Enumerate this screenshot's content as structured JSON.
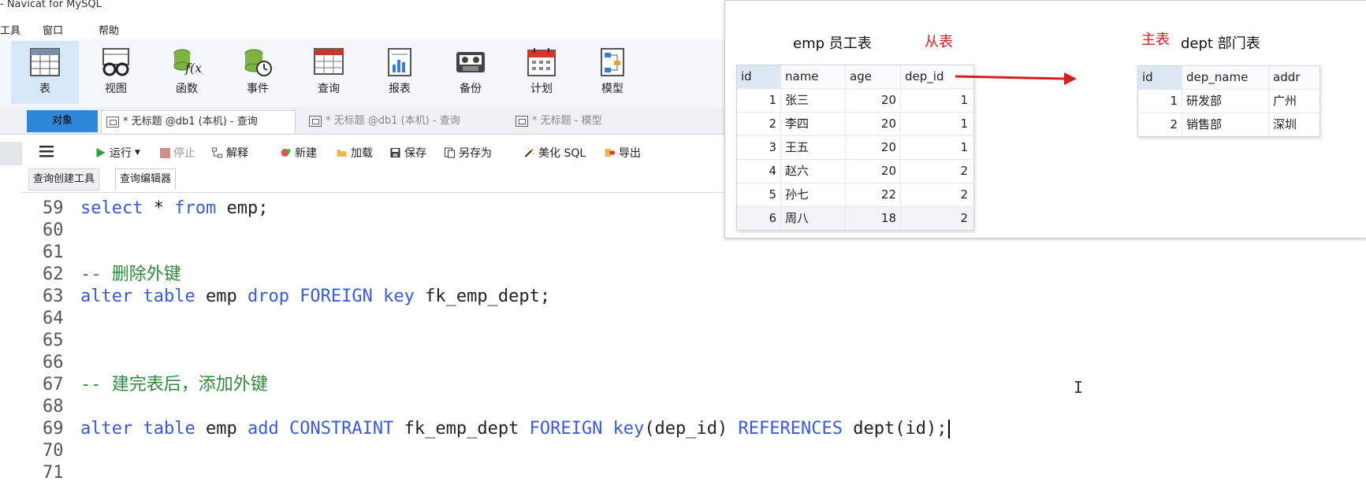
{
  "window": {
    "title": "- Navicat for MySQL"
  },
  "menu": [
    {
      "label": "工具"
    },
    {
      "label": "窗口"
    },
    {
      "label": "帮助"
    }
  ],
  "ribbon": [
    {
      "label": "表",
      "icon": "table-icon",
      "selected": true
    },
    {
      "label": "视图",
      "icon": "view-glasses-icon"
    },
    {
      "label": "函数",
      "icon": "function-icon"
    },
    {
      "label": "事件",
      "icon": "event-clock-icon"
    },
    {
      "label": "查询",
      "icon": "query-table-icon"
    },
    {
      "label": "报表",
      "icon": "report-chart-icon"
    },
    {
      "label": "备份",
      "icon": "backup-tape-icon"
    },
    {
      "label": "计划",
      "icon": "schedule-calendar-icon"
    },
    {
      "label": "模型",
      "icon": "model-diagram-icon"
    }
  ],
  "tabs": [
    {
      "label": "对象"
    },
    {
      "label": "* 无标题 @db1 (本机) - 查询"
    },
    {
      "label": "* 无标题 @db1 (本机) - 查询"
    },
    {
      "label": "* 无标题 - 模型"
    }
  ],
  "toolbar": {
    "run": "运行",
    "stop": "停止",
    "explain": "解释",
    "new": "新建",
    "load": "加载",
    "save": "保存",
    "save_as": "另存为",
    "beautify": "美化 SQL",
    "export": "导出"
  },
  "subtabs": [
    {
      "label": "查询创建工具"
    },
    {
      "label": "查询编辑器"
    }
  ],
  "editor": {
    "lines": [
      {
        "n": "59",
        "kind": "select"
      },
      {
        "n": "60"
      },
      {
        "n": "61"
      },
      {
        "n": "62",
        "comment": "-- 删除外键"
      },
      {
        "n": "63",
        "kind": "drop"
      },
      {
        "n": "64"
      },
      {
        "n": "65"
      },
      {
        "n": "66"
      },
      {
        "n": "67",
        "comment": "-- 建完表后，添加外键"
      },
      {
        "n": "68"
      },
      {
        "n": "69",
        "kind": "add"
      },
      {
        "n": "70"
      },
      {
        "n": "71"
      }
    ],
    "tokens": {
      "select": "select",
      "star_from_sp": " * ",
      "from": "from",
      "emp_semi": " emp;",
      "alter": "alter",
      "table": "table",
      "emp": " emp ",
      "drop": "drop",
      "foreign": "FOREIGN",
      "key": "key",
      "fk_drop": " fk_emp_dept;",
      "add": "add",
      "constraint": "CONSTRAINT",
      "fk_name": " fk_emp_dept ",
      "key_paren": "key",
      "dep_col": "(dep_id) ",
      "references": "REFERENCES",
      "dept_ref": " dept(id);"
    }
  },
  "diagram": {
    "emp_title": "emp 员工表",
    "emp_role": "从表",
    "dept_role": "主表",
    "dept_title": "dept 部门表",
    "arrow_color": "#d42020",
    "emp_table": {
      "columns": [
        "id",
        "name",
        "age",
        "dep_id"
      ],
      "rows": [
        [
          "1",
          "张三",
          "20",
          "1"
        ],
        [
          "2",
          "李四",
          "20",
          "1"
        ],
        [
          "3",
          "王五",
          "20",
          "1"
        ],
        [
          "4",
          "赵六",
          "20",
          "2"
        ],
        [
          "5",
          "孙七",
          "22",
          "2"
        ],
        [
          "6",
          "周八",
          "18",
          "2"
        ]
      ]
    },
    "dept_table": {
      "columns": [
        "id",
        "dep_name",
        "addr"
      ],
      "rows": [
        [
          "1",
          "研发部",
          "广州"
        ],
        [
          "2",
          "销售部",
          "深圳"
        ]
      ]
    }
  },
  "cursor_glyph": "I"
}
